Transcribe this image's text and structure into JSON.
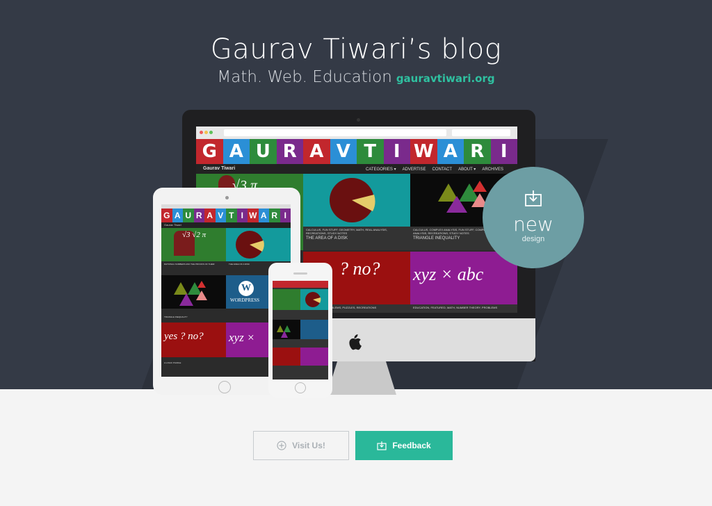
{
  "header": {
    "title": "Gaurav Tiwari’s blog",
    "tagline": "Math. Web. Education",
    "domain": "gauravtiwari.org"
  },
  "site_preview": {
    "logo_letters": [
      "G",
      "A",
      "U",
      "R",
      "A",
      "V",
      "T",
      "I",
      "W",
      "A",
      "R",
      "I"
    ],
    "logo_colors": [
      "#c2272d",
      "#2b8fd6",
      "#2e8b3c",
      "#7a2a8c",
      "#c2272d",
      "#2b8fd6",
      "#2e8b3c",
      "#7a2a8c",
      "#c2272d",
      "#2b8fd6",
      "#2e8b3c",
      "#7a2a8c"
    ],
    "site_name": "Gaurav Tiwari",
    "nav": [
      "CATEGORIES ▾",
      "ADVERTISE",
      "CONTACT",
      "ABOUT ▾",
      "ARCHIVES"
    ],
    "tiles": [
      {
        "math_text": "√3  π",
        "caption": ""
      },
      {
        "caption": "CALCULUS, FUN STUFF, GEOMETRY, MATH, REAL ANALYSIS, RECREATIONS, STUDY NOTES",
        "title": "THE AREA OF A DISK"
      },
      {
        "caption": "CALCULUS, COMPLEX ANALYSIS, FUN STUFF, COMPLEX NUMBERS, REAL ANALYSIS, RECREATIONS, STUDY NOTES",
        "title": "TRIANGLE INEQUALITY"
      },
      {
        "math_text": "? no?",
        "caption": "LOGIC, MATH, PROBLEMS, PUZZLES, RECREATIONS"
      },
      {
        "math_text": "xyz × abc",
        "caption": "EDUCATION, FEATURED, MATH, NUMBER THEORY, PROBLEMS"
      }
    ],
    "ipad_tiles": [
      "√3  √2  π",
      "WORDPRESS",
      "yes ? no?",
      "xyz ×"
    ],
    "ipad_captions": [
      "RATIONAL NUMBERS AND THE PROOFS OF THEIR",
      "THE AREA OF A DISK",
      "TRIANGLE INEQUALITY",
      "A LOGIC PUZZLE"
    ]
  },
  "badge": {
    "label": "new",
    "sublabel": "design"
  },
  "buttons": {
    "visit_label": "Visit Us!",
    "feedback_label": "Feedback"
  },
  "colors": {
    "hero_bg": "#343a46",
    "accent": "#2ab89a",
    "badge": "#6d9ea4",
    "domain_text": "#2fc0a0"
  }
}
